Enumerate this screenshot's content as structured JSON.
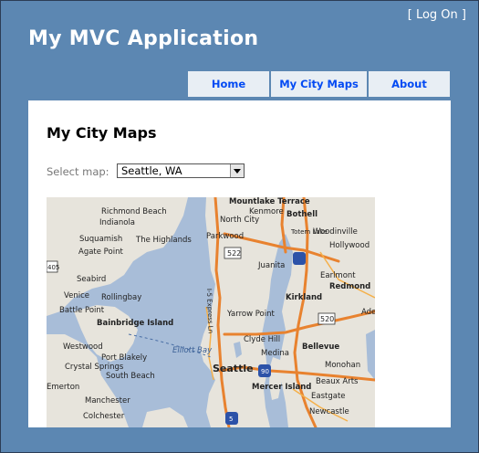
{
  "header": {
    "login_text": "Log On",
    "app_title": "My MVC Application"
  },
  "menu": {
    "tabs": [
      {
        "label": "Home"
      },
      {
        "label": "My City Maps"
      },
      {
        "label": "About"
      }
    ]
  },
  "main": {
    "page_title": "My City Maps",
    "select_label": "Select map:",
    "selected_map": "Seattle, WA"
  },
  "map": {
    "labels": [
      "Mountlake Terrace",
      "Richmond Beach",
      "Bothell",
      "North City",
      "Indianola",
      "Kenmore",
      "Suquamish",
      "The Highlands",
      "Parkwood",
      "Woodinville",
      "Agate Point",
      "Hollywood",
      "522",
      "405",
      "Totem Lake",
      "Juanita",
      "Seabird",
      "Earlmont",
      "Redmond",
      "Venice",
      "Rollingbay",
      "Kirkland",
      "Battle Point",
      "Yarrow Point",
      "520",
      "Bainbridge Island",
      "Ade",
      "Westwood",
      "Clyde Hill",
      "Port Blakely",
      "Elliott Bay",
      "Medina",
      "Bellevue",
      "Crystal Springs",
      "South Beach",
      "Seattle",
      "90",
      "Monohan",
      "Emerton",
      "Mercer Island",
      "Beaux Arts",
      "Manchester",
      "Eastgate",
      "Colchester",
      "Newcastle",
      "5",
      "I-5 Express Ln"
    ],
    "colors": {
      "water": "#a8bdd8",
      "land": "#e7e4dc",
      "highway": "#e8822f",
      "interstate_shield": "#2c52a8"
    }
  }
}
